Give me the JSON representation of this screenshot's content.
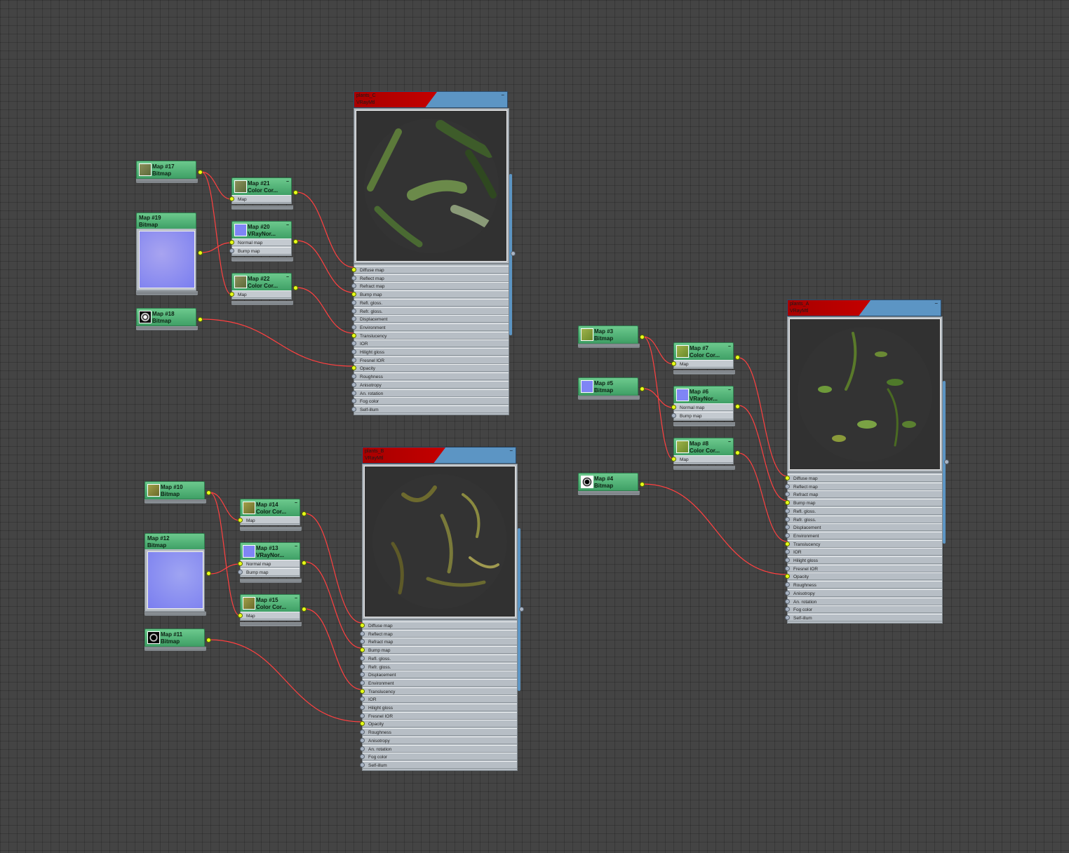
{
  "materials": [
    {
      "id": "C",
      "name": "plants_C",
      "type": "VRayMtl"
    },
    {
      "id": "B",
      "name": "plants_B",
      "type": "VRayMtl"
    },
    {
      "id": "A",
      "name": "plants_A",
      "type": "VRayMtl"
    }
  ],
  "material_slots": [
    "Diffuse map",
    "Reflect map",
    "Refract map",
    "Bump map",
    "Refl. gloss.",
    "Refr. gloss.",
    "Displacement",
    "Environment",
    "Translucency",
    "IOR",
    "Hilight gloss",
    "Fresnel IOR",
    "Opacity",
    "Roughness",
    "Anisotropy",
    "An. rotation",
    "Fog color",
    "Self-illum"
  ],
  "maps": {
    "m17": {
      "title": "Map #17",
      "type": "Bitmap"
    },
    "m21": {
      "title": "Map #21",
      "type": "Color Cor...",
      "slot": "Map"
    },
    "m19": {
      "title": "Map #19",
      "type": "Bitmap"
    },
    "m20": {
      "title": "Map #20",
      "type": "VRayNor...",
      "slot": "Normal map",
      "slot2": "Bump map"
    },
    "m22": {
      "title": "Map #22",
      "type": "Color Cor...",
      "slot": "Map"
    },
    "m18": {
      "title": "Map #18",
      "type": "Bitmap"
    },
    "m10": {
      "title": "Map #10",
      "type": "Bitmap"
    },
    "m14": {
      "title": "Map #14",
      "type": "Color Cor...",
      "slot": "Map"
    },
    "m12": {
      "title": "Map #12",
      "type": "Bitmap"
    },
    "m13": {
      "title": "Map #13",
      "type": "VRayNor...",
      "slot": "Normal map",
      "slot2": "Bump map"
    },
    "m15": {
      "title": "Map #15",
      "type": "Color Cor...",
      "slot": "Map"
    },
    "m11": {
      "title": "Map #11",
      "type": "Bitmap"
    },
    "m3": {
      "title": "Map #3",
      "type": "Bitmap"
    },
    "m7": {
      "title": "Map #7",
      "type": "Color Cor...",
      "slot": "Map"
    },
    "m5": {
      "title": "Map #5",
      "type": "Bitmap"
    },
    "m6": {
      "title": "Map #6",
      "type": "VRayNor...",
      "slot": "Normal map",
      "slot2": "Bump map"
    },
    "m8": {
      "title": "Map #8",
      "type": "Color Cor...",
      "slot": "Map"
    },
    "m4": {
      "title": "Map #4",
      "type": "Bitmap"
    }
  },
  "colors": {
    "wire": "#ff4040",
    "node_green": "#4fb374",
    "mat_red": "#b80000",
    "mat_blue": "#5c95c4",
    "socket_active": "#e8ff1a"
  }
}
